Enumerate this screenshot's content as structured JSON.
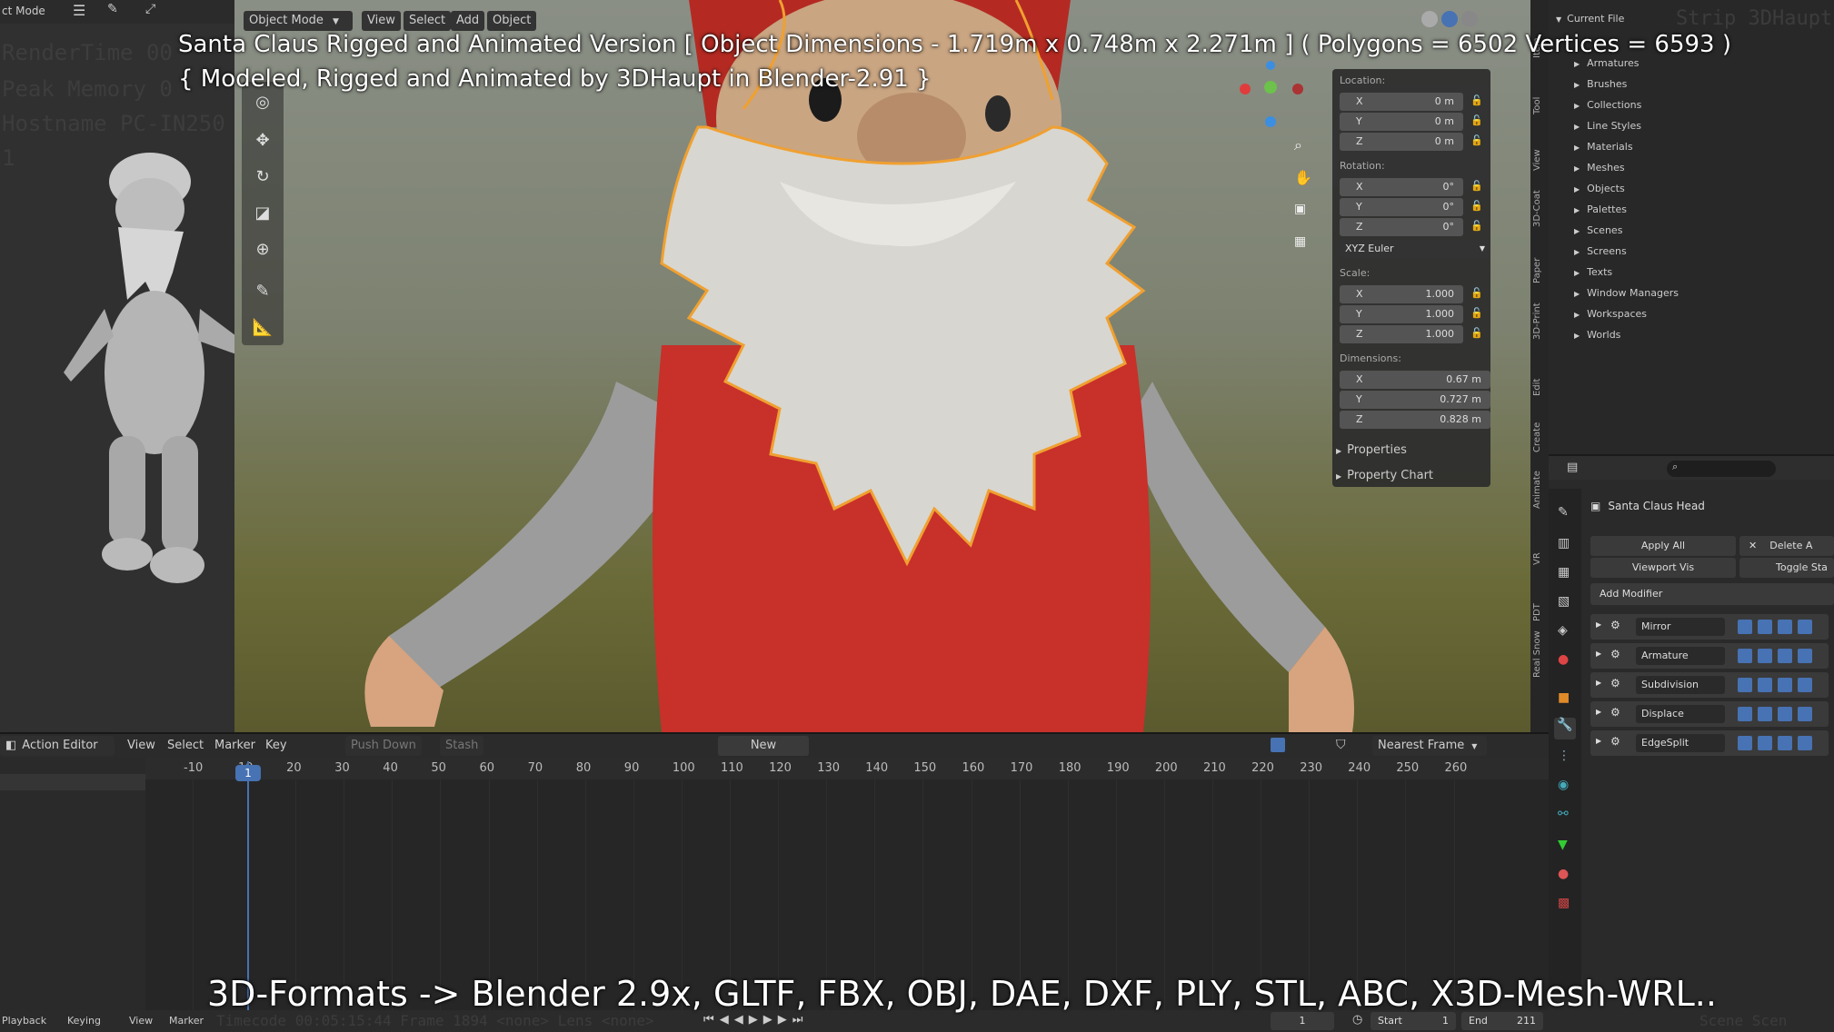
{
  "overlay": {
    "title_line1": "Santa Claus Rigged and Animated Version [ Object Dimensions -  1.719m x 0.748m x 2.271m ] ( Polygons = 6502  Vertices = 6593 )",
    "title_line2": "{ Modeled, Rigged and Animated by 3DHaupt in Blender-2.91 }",
    "formats_line": "3D-Formats -> Blender 2.9x, GLTF, FBX, OBJ, DAE, DXF, PLY, STL, ABC, X3D-Mesh-WRL.."
  },
  "left_panel": {
    "mode_label": "ct Mode",
    "ghost_lines": [
      "RenderTime 00",
      "Peak Memory 0",
      "Hostname PC-IN250",
      "1"
    ]
  },
  "viewport_header": {
    "mode": "Object Mode",
    "menu": [
      "View",
      "Select",
      "Add",
      "Object"
    ]
  },
  "n_panel": {
    "location_label": "Location:",
    "location": [
      {
        "axis": "X",
        "value": "0 m"
      },
      {
        "axis": "Y",
        "value": "0 m"
      },
      {
        "axis": "Z",
        "value": "0 m"
      }
    ],
    "rotation_label": "Rotation:",
    "rotation": [
      {
        "axis": "X",
        "value": "0°"
      },
      {
        "axis": "Y",
        "value": "0°"
      },
      {
        "axis": "Z",
        "value": "0°"
      }
    ],
    "rotation_mode": "XYZ Euler",
    "scale_label": "Scale:",
    "scale": [
      {
        "axis": "X",
        "value": "1.000"
      },
      {
        "axis": "Y",
        "value": "1.000"
      },
      {
        "axis": "Z",
        "value": "1.000"
      }
    ],
    "dimensions_label": "Dimensions:",
    "dimensions": [
      {
        "axis": "X",
        "value": "0.67 m"
      },
      {
        "axis": "Y",
        "value": "0.727 m"
      },
      {
        "axis": "Z",
        "value": "0.828 m"
      }
    ],
    "properties": "Properties",
    "property_chart": "Property Chart",
    "side_tabs": [
      "Item",
      "Tool",
      "View",
      "3D-Coat",
      "Paper",
      "3D-Print",
      "Edit",
      "Create",
      "Animate",
      "VR",
      "PDT",
      "Real Snow"
    ]
  },
  "outliner": {
    "header": "Current File",
    "ghost": "Strip 3DHaupt",
    "items": [
      "Armatures",
      "Brushes",
      "Collections",
      "Line Styles",
      "Materials",
      "Meshes",
      "Objects",
      "Palettes",
      "Scenes",
      "Screens",
      "Texts",
      "Window Managers",
      "Workspaces",
      "Worlds"
    ]
  },
  "properties_panel": {
    "object_name": "Santa Claus Head",
    "apply_all": "Apply All",
    "delete": "Delete A",
    "viewport_vis": "Viewport Vis",
    "toggle_stack": "Toggle Sta",
    "add_modifier": "Add Modifier",
    "modifiers": [
      "Mirror",
      "Armature",
      "Subdivision",
      "Displace",
      "EdgeSplit"
    ]
  },
  "timeline": {
    "editor": "Action Editor",
    "menu": [
      "View",
      "Select",
      "Marker",
      "Key"
    ],
    "push_down": "Push Down",
    "stash": "Stash",
    "new": "New",
    "snap": "Nearest Frame",
    "current_frame": "1",
    "ticks": [
      "-10",
      "10",
      "20",
      "30",
      "40",
      "50",
      "60",
      "70",
      "80",
      "90",
      "100",
      "110",
      "120",
      "130",
      "140",
      "150",
      "160",
      "170",
      "180",
      "190",
      "200",
      "210",
      "220",
      "230",
      "240",
      "250",
      "260"
    ]
  },
  "status_bar": {
    "playback": "Playback",
    "keying": "Keying",
    "view": "View",
    "marker": "Marker",
    "frame": "1",
    "start_label": "Start",
    "start": "1",
    "end_label": "End",
    "end": "211",
    "ghost": "Timecode 00:05:15:44    Frame 1894    <none>    Lens <none>",
    "scene_ghost": "Scene Scen"
  },
  "colors": {
    "accent_blue": "#4772b3",
    "selection_orange": "#f0a030",
    "suit_red": "#c8302a"
  }
}
